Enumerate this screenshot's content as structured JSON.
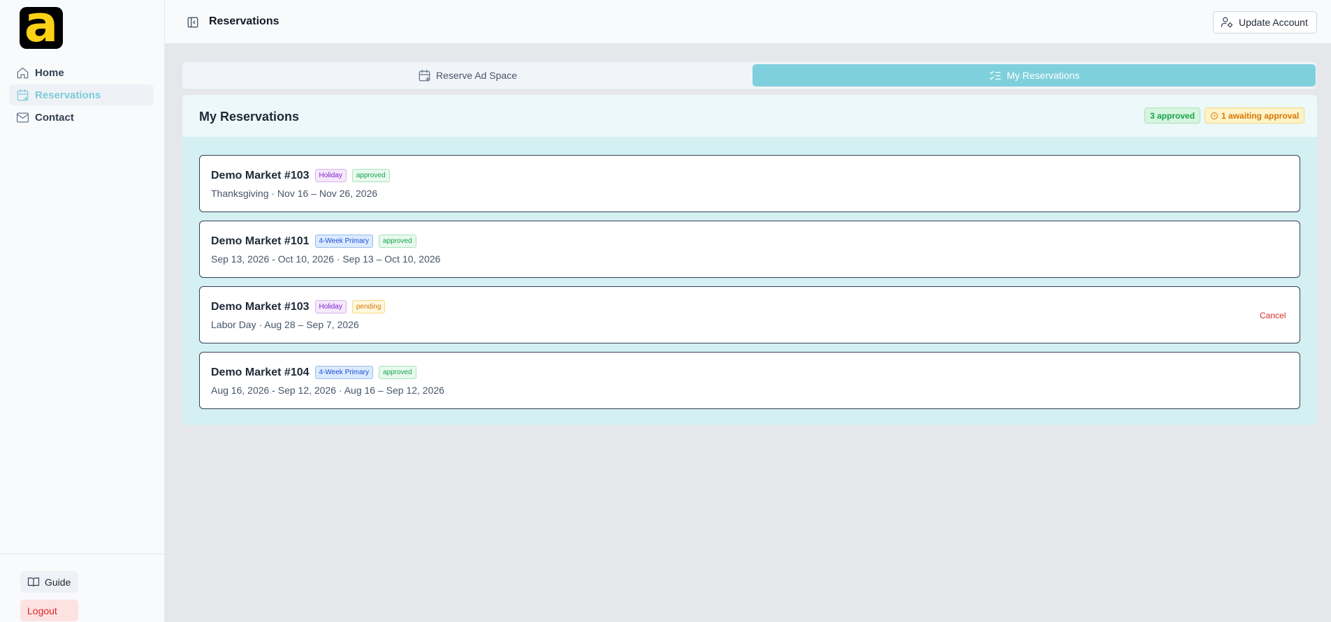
{
  "app": {
    "logo_letter": "a"
  },
  "sidebar": {
    "items": [
      {
        "label": "Home",
        "icon": "home-icon",
        "active": false
      },
      {
        "label": "Reservations",
        "icon": "calendar-plus-icon",
        "active": true
      },
      {
        "label": "Contact",
        "icon": "mail-icon",
        "active": false
      }
    ],
    "guide_label": "Guide",
    "logout_label": "Logout"
  },
  "header": {
    "title": "Reservations",
    "update_account_label": "Update Account"
  },
  "tabs": {
    "reserve_label": "Reserve Ad Space",
    "mine_label": "My Reservations",
    "active": "mine"
  },
  "panel": {
    "title": "My Reservations",
    "approved_badge": "3 approved",
    "awaiting_badge": "1 awaiting approval",
    "reservations": [
      {
        "name": "Demo Market #103",
        "type": "Holiday",
        "status": "approved",
        "details": "Thanksgiving · Nov 16 – Nov 26, 2026"
      },
      {
        "name": "Demo Market #101",
        "type": "4-Week Primary",
        "status": "approved",
        "details": "Sep 13, 2026 - Oct 10, 2026 · Sep 13 – Oct 10, 2026"
      },
      {
        "name": "Demo Market #103",
        "type": "Holiday",
        "status": "pending",
        "details": "Labor Day · Aug 28 – Sep 7, 2026",
        "action": "Cancel"
      },
      {
        "name": "Demo Market #104",
        "type": "4-Week Primary",
        "status": "approved",
        "details": "Aug 16, 2026 - Sep 12, 2026 · Aug 16 – Sep 12, 2026"
      }
    ]
  },
  "colors": {
    "accent": "#7fd0dd",
    "logo_yellow": "#fcd116",
    "danger": "#dc2626",
    "success": "#16a34a",
    "warning": "#d97706"
  }
}
